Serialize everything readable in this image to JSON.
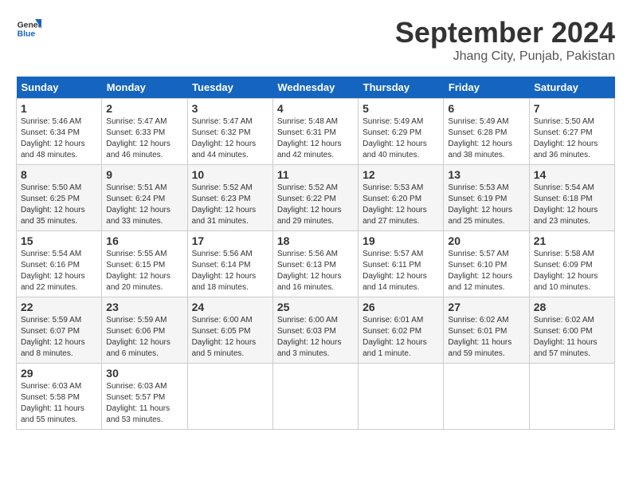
{
  "logo": {
    "line1": "General",
    "line2": "Blue"
  },
  "title": "September 2024",
  "subtitle": "Jhang City, Punjab, Pakistan",
  "days_of_week": [
    "Sunday",
    "Monday",
    "Tuesday",
    "Wednesday",
    "Thursday",
    "Friday",
    "Saturday"
  ],
  "weeks": [
    [
      {
        "day": "1",
        "sunrise": "Sunrise: 5:46 AM",
        "sunset": "Sunset: 6:34 PM",
        "daylight": "Daylight: 12 hours and 48 minutes."
      },
      {
        "day": "2",
        "sunrise": "Sunrise: 5:47 AM",
        "sunset": "Sunset: 6:33 PM",
        "daylight": "Daylight: 12 hours and 46 minutes."
      },
      {
        "day": "3",
        "sunrise": "Sunrise: 5:47 AM",
        "sunset": "Sunset: 6:32 PM",
        "daylight": "Daylight: 12 hours and 44 minutes."
      },
      {
        "day": "4",
        "sunrise": "Sunrise: 5:48 AM",
        "sunset": "Sunset: 6:31 PM",
        "daylight": "Daylight: 12 hours and 42 minutes."
      },
      {
        "day": "5",
        "sunrise": "Sunrise: 5:49 AM",
        "sunset": "Sunset: 6:29 PM",
        "daylight": "Daylight: 12 hours and 40 minutes."
      },
      {
        "day": "6",
        "sunrise": "Sunrise: 5:49 AM",
        "sunset": "Sunset: 6:28 PM",
        "daylight": "Daylight: 12 hours and 38 minutes."
      },
      {
        "day": "7",
        "sunrise": "Sunrise: 5:50 AM",
        "sunset": "Sunset: 6:27 PM",
        "daylight": "Daylight: 12 hours and 36 minutes."
      }
    ],
    [
      {
        "day": "8",
        "sunrise": "Sunrise: 5:50 AM",
        "sunset": "Sunset: 6:25 PM",
        "daylight": "Daylight: 12 hours and 35 minutes."
      },
      {
        "day": "9",
        "sunrise": "Sunrise: 5:51 AM",
        "sunset": "Sunset: 6:24 PM",
        "daylight": "Daylight: 12 hours and 33 minutes."
      },
      {
        "day": "10",
        "sunrise": "Sunrise: 5:52 AM",
        "sunset": "Sunset: 6:23 PM",
        "daylight": "Daylight: 12 hours and 31 minutes."
      },
      {
        "day": "11",
        "sunrise": "Sunrise: 5:52 AM",
        "sunset": "Sunset: 6:22 PM",
        "daylight": "Daylight: 12 hours and 29 minutes."
      },
      {
        "day": "12",
        "sunrise": "Sunrise: 5:53 AM",
        "sunset": "Sunset: 6:20 PM",
        "daylight": "Daylight: 12 hours and 27 minutes."
      },
      {
        "day": "13",
        "sunrise": "Sunrise: 5:53 AM",
        "sunset": "Sunset: 6:19 PM",
        "daylight": "Daylight: 12 hours and 25 minutes."
      },
      {
        "day": "14",
        "sunrise": "Sunrise: 5:54 AM",
        "sunset": "Sunset: 6:18 PM",
        "daylight": "Daylight: 12 hours and 23 minutes."
      }
    ],
    [
      {
        "day": "15",
        "sunrise": "Sunrise: 5:54 AM",
        "sunset": "Sunset: 6:16 PM",
        "daylight": "Daylight: 12 hours and 22 minutes."
      },
      {
        "day": "16",
        "sunrise": "Sunrise: 5:55 AM",
        "sunset": "Sunset: 6:15 PM",
        "daylight": "Daylight: 12 hours and 20 minutes."
      },
      {
        "day": "17",
        "sunrise": "Sunrise: 5:56 AM",
        "sunset": "Sunset: 6:14 PM",
        "daylight": "Daylight: 12 hours and 18 minutes."
      },
      {
        "day": "18",
        "sunrise": "Sunrise: 5:56 AM",
        "sunset": "Sunset: 6:13 PM",
        "daylight": "Daylight: 12 hours and 16 minutes."
      },
      {
        "day": "19",
        "sunrise": "Sunrise: 5:57 AM",
        "sunset": "Sunset: 6:11 PM",
        "daylight": "Daylight: 12 hours and 14 minutes."
      },
      {
        "day": "20",
        "sunrise": "Sunrise: 5:57 AM",
        "sunset": "Sunset: 6:10 PM",
        "daylight": "Daylight: 12 hours and 12 minutes."
      },
      {
        "day": "21",
        "sunrise": "Sunrise: 5:58 AM",
        "sunset": "Sunset: 6:09 PM",
        "daylight": "Daylight: 12 hours and 10 minutes."
      }
    ],
    [
      {
        "day": "22",
        "sunrise": "Sunrise: 5:59 AM",
        "sunset": "Sunset: 6:07 PM",
        "daylight": "Daylight: 12 hours and 8 minutes."
      },
      {
        "day": "23",
        "sunrise": "Sunrise: 5:59 AM",
        "sunset": "Sunset: 6:06 PM",
        "daylight": "Daylight: 12 hours and 6 minutes."
      },
      {
        "day": "24",
        "sunrise": "Sunrise: 6:00 AM",
        "sunset": "Sunset: 6:05 PM",
        "daylight": "Daylight: 12 hours and 5 minutes."
      },
      {
        "day": "25",
        "sunrise": "Sunrise: 6:00 AM",
        "sunset": "Sunset: 6:03 PM",
        "daylight": "Daylight: 12 hours and 3 minutes."
      },
      {
        "day": "26",
        "sunrise": "Sunrise: 6:01 AM",
        "sunset": "Sunset: 6:02 PM",
        "daylight": "Daylight: 12 hours and 1 minute."
      },
      {
        "day": "27",
        "sunrise": "Sunrise: 6:02 AM",
        "sunset": "Sunset: 6:01 PM",
        "daylight": "Daylight: 11 hours and 59 minutes."
      },
      {
        "day": "28",
        "sunrise": "Sunrise: 6:02 AM",
        "sunset": "Sunset: 6:00 PM",
        "daylight": "Daylight: 11 hours and 57 minutes."
      }
    ],
    [
      {
        "day": "29",
        "sunrise": "Sunrise: 6:03 AM",
        "sunset": "Sunset: 5:58 PM",
        "daylight": "Daylight: 11 hours and 55 minutes."
      },
      {
        "day": "30",
        "sunrise": "Sunrise: 6:03 AM",
        "sunset": "Sunset: 5:57 PM",
        "daylight": "Daylight: 11 hours and 53 minutes."
      },
      null,
      null,
      null,
      null,
      null
    ]
  ]
}
